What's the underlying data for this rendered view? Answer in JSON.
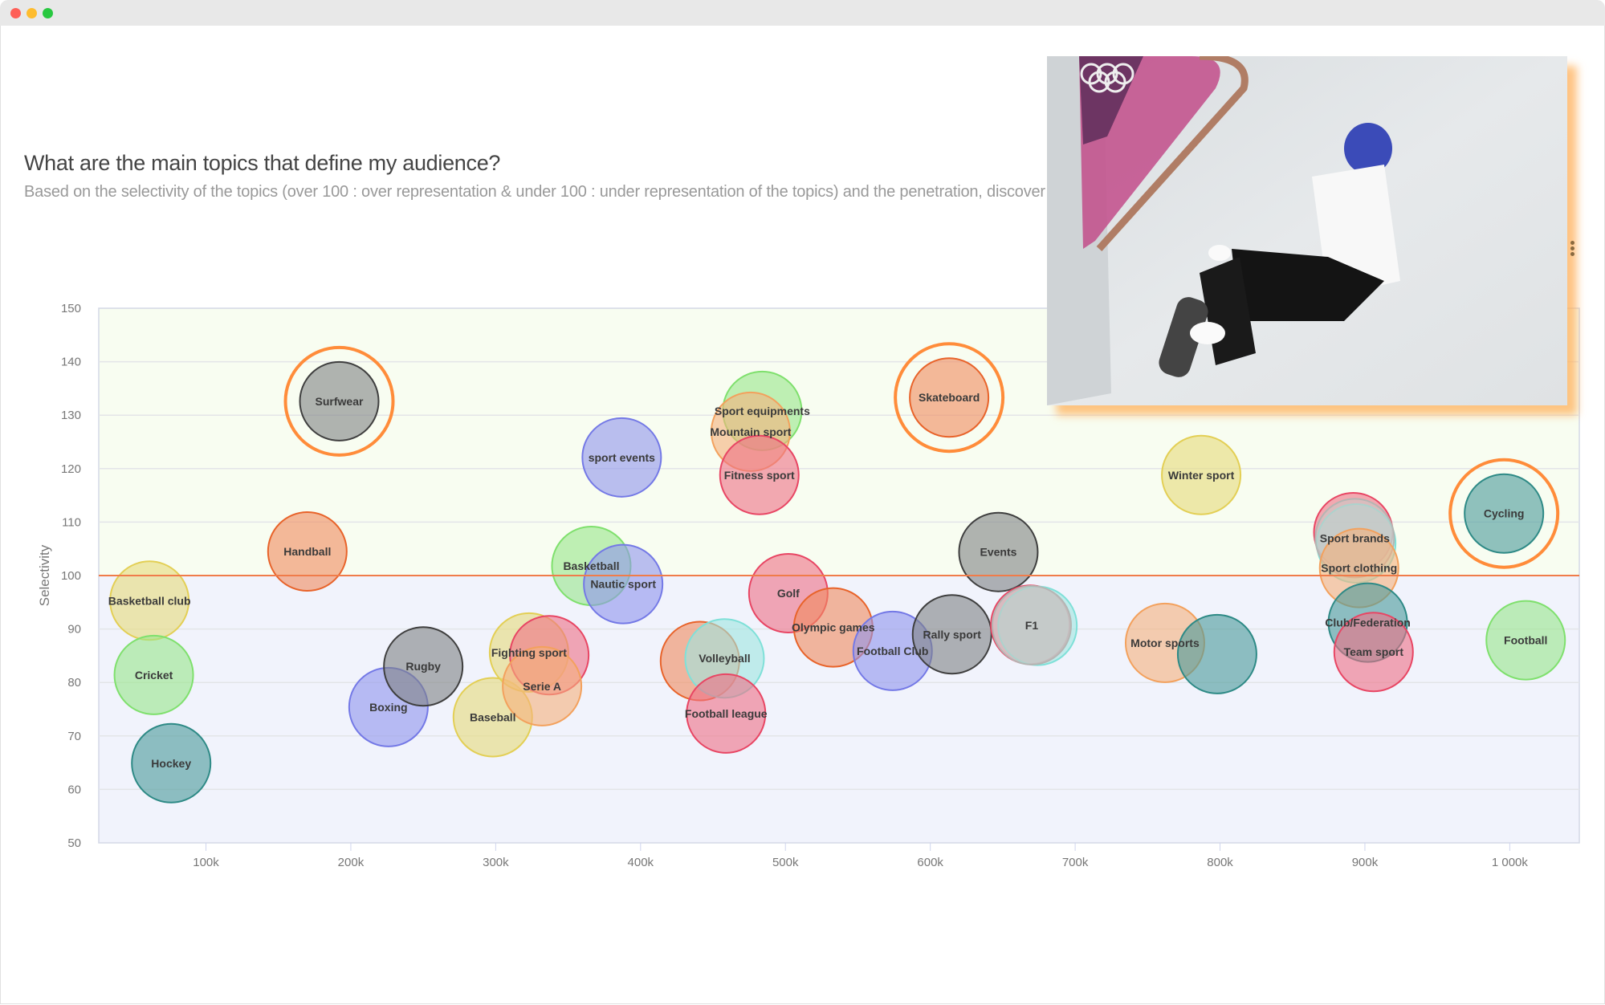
{
  "window": {
    "controls": [
      "close",
      "minimize",
      "maximize"
    ]
  },
  "header": {
    "title": "What are the main topics that define my audience?",
    "subtitle": "Based on the selectivity of the topics (over 100 : over representation & under 100 : under representation of the topics) and the penetration, discover the"
  },
  "photo": {
    "description": "Skateboarder in blue helmet riding a concrete bowl with Olympic rings banner",
    "icon": "image-icon"
  },
  "colors": {
    "reference_line": "#f07c4a",
    "above_zone": "#f8fdf1",
    "below_zone": "#f1f3fc",
    "highlight_ring": "#ff8c3a",
    "palette": {
      "gray": "#7f8283",
      "orange": "#f08a5d",
      "yellow": "#e6db7a",
      "green": "#98e68a",
      "teal": "#4a9a9a",
      "blue": "#8f94ec",
      "red": "#ef6f86",
      "peach": "#f5b07c",
      "cyan": "#9ee6e0",
      "lightgray": "#c9c9c7"
    }
  },
  "chart_data": {
    "type": "scatter",
    "subtype": "bubble",
    "title": "What are the main topics that define my audience?",
    "xlabel": "",
    "ylabel": "Selectivity",
    "xlim": [
      26000,
      1048000
    ],
    "ylim": [
      50,
      150
    ],
    "xticks": [
      100000,
      200000,
      300000,
      400000,
      500000,
      600000,
      700000,
      800000,
      900000,
      1000000
    ],
    "xtick_labels": [
      "100k",
      "200k",
      "300k",
      "400k",
      "500k",
      "600k",
      "700k",
      "800k",
      "900k",
      "1 000k"
    ],
    "yticks": [
      50,
      60,
      70,
      80,
      90,
      100,
      110,
      120,
      130,
      140,
      150
    ],
    "ytick_labels": [
      "50",
      "60",
      "70",
      "80",
      "90",
      "100",
      "110",
      "120",
      "130",
      "140",
      "150"
    ],
    "grid": true,
    "reference_line": {
      "y": 100,
      "label": ""
    },
    "zones": [
      {
        "from": 100,
        "to": 150,
        "name": "over representation"
      },
      {
        "from": 50,
        "to": 100,
        "name": "under representation"
      }
    ],
    "points": [
      {
        "label": "Surfwear",
        "x": 192000,
        "y": 132.6,
        "color": "gray",
        "highlighted": true
      },
      {
        "label": "Handball",
        "x": 170000,
        "y": 104.5,
        "color": "orange",
        "highlighted": false
      },
      {
        "label": "Basketball club",
        "x": 61000,
        "y": 95.3,
        "color": "yellow",
        "highlighted": false
      },
      {
        "label": "Cricket",
        "x": 64000,
        "y": 81.4,
        "color": "green",
        "highlighted": false
      },
      {
        "label": "Hockey",
        "x": 76000,
        "y": 64.9,
        "color": "teal",
        "highlighted": false
      },
      {
        "label": "Boxing",
        "x": 226000,
        "y": 75.4,
        "color": "blue",
        "highlighted": false
      },
      {
        "label": "Rugby",
        "x": 250000,
        "y": 83.0,
        "color": "gray",
        "highlighted": false
      },
      {
        "label": "Baseball",
        "x": 298000,
        "y": 73.5,
        "color": "yellow",
        "highlighted": false
      },
      {
        "label": "Fighting sport",
        "x": 323000,
        "y": 85.6,
        "color": "yellow",
        "highlighted": false
      },
      {
        "label": "",
        "x": 337000,
        "y": 85.1,
        "color": "red",
        "highlighted": false
      },
      {
        "label": "Serie A",
        "x": 332000,
        "y": 79.3,
        "color": "peach",
        "highlighted": false
      },
      {
        "label": "sport events",
        "x": 387000,
        "y": 122.1,
        "color": "blue",
        "highlighted": false
      },
      {
        "label": "Basketball",
        "x": 366000,
        "y": 101.8,
        "color": "green",
        "highlighted": false
      },
      {
        "label": "Nautic sport",
        "x": 388000,
        "y": 98.4,
        "color": "blue",
        "highlighted": false
      },
      {
        "label": "Sport equipments",
        "x": 484000,
        "y": 130.8,
        "color": "green",
        "highlighted": false
      },
      {
        "label": "Mountain sport",
        "x": 476000,
        "y": 126.9,
        "color": "peach",
        "highlighted": false
      },
      {
        "label": "Fitness sport",
        "x": 482000,
        "y": 118.8,
        "color": "red",
        "highlighted": false
      },
      {
        "label": "",
        "x": 441000,
        "y": 84.0,
        "color": "orange",
        "highlighted": false
      },
      {
        "label": "Volleyball",
        "x": 458000,
        "y": 84.5,
        "color": "cyan",
        "highlighted": false
      },
      {
        "label": "Football league",
        "x": 459000,
        "y": 74.2,
        "color": "red",
        "highlighted": false
      },
      {
        "label": "Golf",
        "x": 502000,
        "y": 96.7,
        "color": "red",
        "highlighted": false
      },
      {
        "label": "Olympic games",
        "x": 533000,
        "y": 90.3,
        "color": "orange",
        "highlighted": false
      },
      {
        "label": "Football Club",
        "x": 574000,
        "y": 85.9,
        "color": "blue",
        "highlighted": false
      },
      {
        "label": "Skateboard",
        "x": 613000,
        "y": 133.3,
        "color": "orange",
        "highlighted": true
      },
      {
        "label": "Events",
        "x": 647000,
        "y": 104.4,
        "color": "gray",
        "highlighted": false
      },
      {
        "label": "Rally sport",
        "x": 615000,
        "y": 89.0,
        "color": "gray",
        "highlighted": false
      },
      {
        "label": "",
        "x": 669000,
        "y": 90.8,
        "color": "red",
        "highlighted": false
      },
      {
        "label": "",
        "x": 674000,
        "y": 90.6,
        "color": "cyan",
        "highlighted": false
      },
      {
        "label": "F1",
        "x": 670000,
        "y": 90.7,
        "color": "lightgray",
        "highlighted": false
      },
      {
        "label": "Winter sport",
        "x": 787000,
        "y": 118.8,
        "color": "yellow",
        "highlighted": false
      },
      {
        "label": "Motor sports",
        "x": 762000,
        "y": 87.4,
        "color": "peach",
        "highlighted": false
      },
      {
        "label": "",
        "x": 798000,
        "y": 85.3,
        "color": "teal",
        "highlighted": false
      },
      {
        "label": "",
        "x": 892000,
        "y": 108.1,
        "color": "red",
        "highlighted": false
      },
      {
        "label": "",
        "x": 894000,
        "y": 106.0,
        "color": "cyan",
        "highlighted": false
      },
      {
        "label": "Sport brands",
        "x": 893000,
        "y": 107.0,
        "color": "lightgray",
        "highlighted": false
      },
      {
        "label": "Sport clothing",
        "x": 896000,
        "y": 101.4,
        "color": "peach",
        "highlighted": false
      },
      {
        "label": "Club/Federation",
        "x": 902000,
        "y": 91.2,
        "color": "teal",
        "highlighted": false
      },
      {
        "label": "Team sport",
        "x": 906000,
        "y": 85.7,
        "color": "red",
        "highlighted": false
      },
      {
        "label": "Cycling",
        "x": 996000,
        "y": 111.6,
        "color": "teal",
        "highlighted": true
      },
      {
        "label": "Football",
        "x": 1011000,
        "y": 87.9,
        "color": "green",
        "highlighted": false
      }
    ]
  }
}
